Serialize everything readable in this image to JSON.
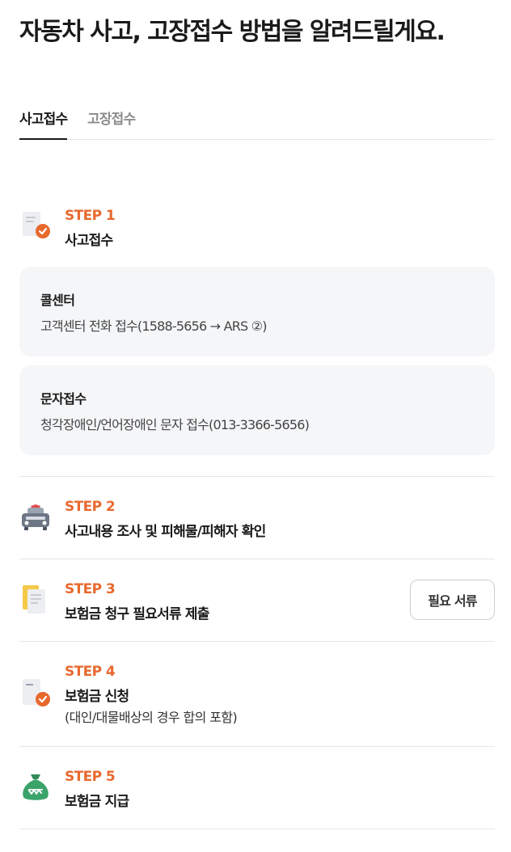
{
  "page": {
    "title": "자동차 사고, 고장접수 방법을 알려드릴게요."
  },
  "tabs": [
    {
      "label": "사고접수",
      "active": true
    },
    {
      "label": "고장접수",
      "active": false
    }
  ],
  "steps": [
    {
      "label": "STEP 1",
      "title": "사고접수",
      "icon": "document-check-icon"
    },
    {
      "label": "STEP 2",
      "title": "사고내용 조사 및 피해물/피해자 확인",
      "icon": "car-siren-icon"
    },
    {
      "label": "STEP 3",
      "title": "보험금 청구 필요서류 제출",
      "icon": "documents-icon"
    },
    {
      "label": "STEP 4",
      "title": "보험금 신청",
      "note": "(대인/대물배상의 경우 합의 포함)",
      "icon": "document-check-icon"
    },
    {
      "label": "STEP 5",
      "title": "보험금 지급",
      "icon": "money-bag-icon"
    }
  ],
  "cards": [
    {
      "title": "콜센터",
      "desc": "고객센터 전화 접수(1588-5656 → ARS ②)"
    },
    {
      "title": "문자접수",
      "desc": "청각장애인/언어장애인 문자 접수(013-3366-5656)"
    }
  ],
  "buttons": {
    "required_docs": "필요 서류"
  },
  "colors": {
    "accent": "#e8692e",
    "card_bg": "#f5f6f8",
    "divider": "#e6e6e6",
    "money_green": "#3aa36a"
  }
}
